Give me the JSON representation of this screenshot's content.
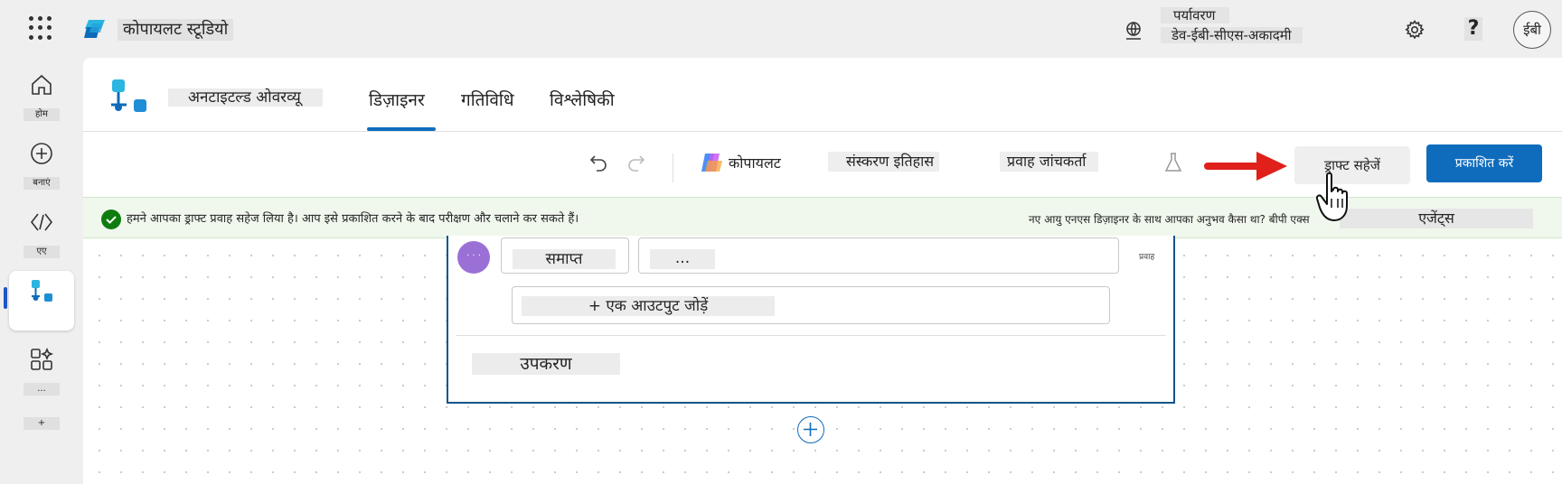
{
  "app": {
    "title": "कोपायलट स्टूडियो"
  },
  "environment": {
    "label": "पर्यावरण",
    "value": "डेव-ईबी-सीएस-अकादमी"
  },
  "user": {
    "initials": "ईबी"
  },
  "help": {
    "label": "?"
  },
  "nav": {
    "items": [
      {
        "label": "होम"
      },
      {
        "label": "बनाएं"
      },
      {
        "label": "एए"
      },
      {
        "label": ""
      },
      {
        "label": "..."
      },
      {
        "label": "+"
      }
    ]
  },
  "flow": {
    "name": "अनटाइटल्ड ओवरव्यू"
  },
  "tabs": [
    {
      "label": "डिज़ाइनर",
      "active": true
    },
    {
      "label": "गतिविधि",
      "active": false
    },
    {
      "label": "विश्लेषिकी",
      "active": false
    }
  ],
  "toolbar": {
    "copilot_label": "कोपायलट",
    "version_history_label": "संस्करण इतिहास",
    "flow_checker_label": "प्रवाह जांचकर्ता",
    "save_draft_label": "ड्राफ्ट सहेजें",
    "publish_label": "प्रकाशित करें"
  },
  "banner": {
    "message": "हमने आपका ड्राफ्ट प्रवाह सहेज लिया है। आप इसे प्रकाशित करने के बाद परीक्षण और चलाने कर सकते हैं।",
    "feedback": "नए आयु एनएस डिज़ाइनर के साथ आपका अनुभव कैसा था? बीपी एक्स",
    "agents_label": "एजेंट्स"
  },
  "node": {
    "avatar_text": "· · ·",
    "output_name": "समाप्त",
    "output_value": "...",
    "flow_tag": "प्रवाह",
    "add_output_label": "+ एक आउटपुट जोड़ें",
    "tools_label": "उपकरण"
  },
  "colors": {
    "primary": "#0f6cbd",
    "success": "#107c10",
    "banner_bg": "#f0f8ee",
    "arrow": "#e0201b",
    "node_avatar": "#9b70d6"
  }
}
